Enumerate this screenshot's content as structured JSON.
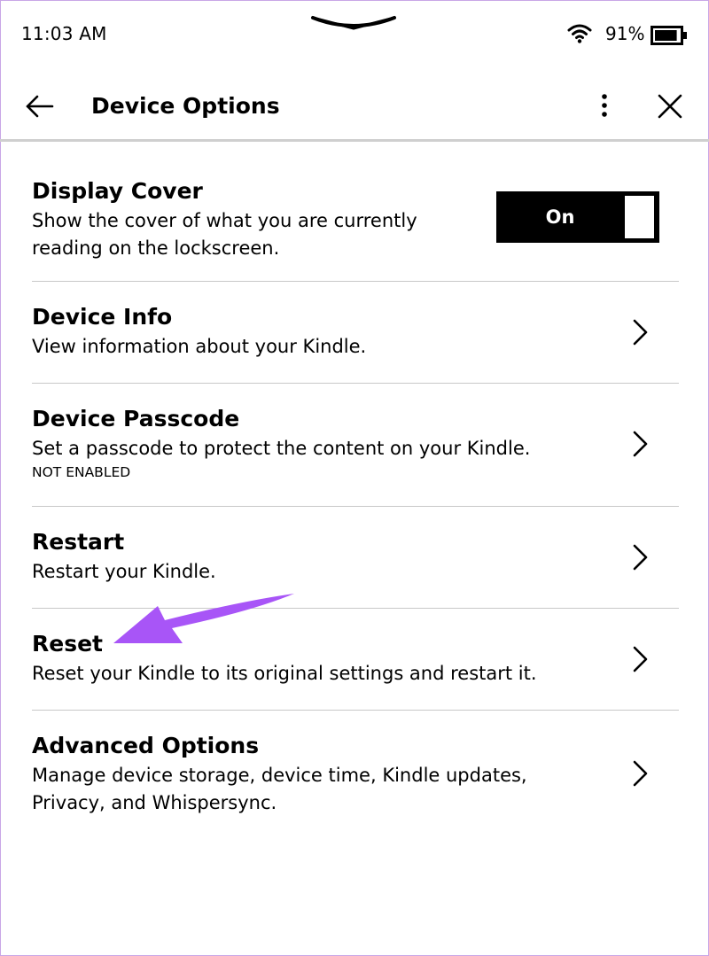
{
  "status_bar": {
    "time": "11:03 AM",
    "battery_percent": "91%",
    "battery_level": 0.91
  },
  "header": {
    "title": "Device Options"
  },
  "settings": [
    {
      "title": "Display Cover",
      "description_lines": [
        "Show the cover of what you are currently",
        "reading on the lockscreen."
      ],
      "toggle_label": "On",
      "toggle_state": true
    },
    {
      "title": "Device Info",
      "description_lines": [
        "View information about your Kindle."
      ]
    },
    {
      "title": "Device Passcode",
      "description_lines": [
        "Set a passcode to protect the content on your Kindle."
      ],
      "status": "NOT ENABLED"
    },
    {
      "title": "Restart",
      "description_lines": [
        "Restart your Kindle."
      ]
    },
    {
      "title": "Reset",
      "description_lines": [
        "Reset your Kindle to its original settings and restart it."
      ]
    },
    {
      "title": "Advanced Options",
      "description_lines": [
        "Manage device storage, device time, Kindle updates,",
        "Privacy, and Whispersync."
      ]
    }
  ],
  "icons": {
    "back": "arrow-left-icon",
    "more": "more-vertical-icon",
    "close": "close-icon",
    "chevron": "chevron-right-icon",
    "wifi": "wifi-icon",
    "battery": "battery-icon",
    "pull_handle": "chevron-down-icon"
  },
  "colors": {
    "annotation_arrow": "#a855f7",
    "frame_border": "#c9a6e6",
    "divider": "#c8c8c8",
    "toggle_background": "#000000"
  }
}
